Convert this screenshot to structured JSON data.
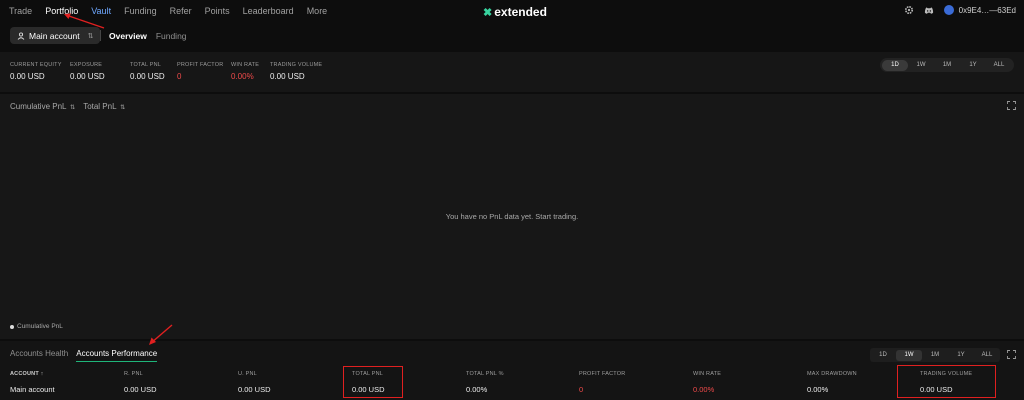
{
  "nav": {
    "links": [
      "Trade",
      "Portfolio",
      "Vault",
      "Funding",
      "Refer",
      "Points",
      "Leaderboard",
      "More"
    ],
    "logo_text": "extended",
    "wallet": "0x9E4…—63Ed"
  },
  "subheader": {
    "account_select": "Main account",
    "tabs": [
      "Overview",
      "Funding"
    ]
  },
  "stats": {
    "items": [
      {
        "label": "CURRENT EQUITY",
        "value": "0.00 USD"
      },
      {
        "label": "EXPOSURE",
        "value": "0.00 USD"
      },
      {
        "label": "TOTAL PNL",
        "value": "0.00 USD"
      },
      {
        "label": "PROFIT FACTOR",
        "value": "0"
      },
      {
        "label": "WIN RATE",
        "value": "0.00%"
      },
      {
        "label": "TRADING VOLUME",
        "value": "0.00 USD"
      }
    ],
    "ranges": [
      "1D",
      "1W",
      "1M",
      "1Y",
      "ALL"
    ],
    "active_range": "1D"
  },
  "chart": {
    "selectors": [
      "Cumulative PnL",
      "Total PnL"
    ],
    "empty_message": "You have no PnL data yet. Start trading.",
    "legend": "Cumulative PnL"
  },
  "accounts": {
    "tabs": [
      "Accounts Health",
      "Accounts Performance"
    ],
    "ranges": [
      "1D",
      "1W",
      "1M",
      "1Y",
      "ALL"
    ],
    "active_range": "1W",
    "columns": [
      "ACCOUNT ↑",
      "R. PNL",
      "U. PNL",
      "TOTAL PNL",
      "TOTAL PNL %",
      "PROFIT FACTOR",
      "WIN RATE",
      "MAX DRAWDOWN",
      "TRADING VOLUME"
    ],
    "rows": [
      [
        "Main account",
        "0.00 USD",
        "0.00 USD",
        "0.00 USD",
        "0.00%",
        "0",
        "0.00%",
        "0.00%",
        "0.00 USD"
      ]
    ]
  },
  "colors": {
    "accent_green": "#1fb57a",
    "negative_red": "#ef4a4a",
    "link_blue": "#6fa8ff",
    "annotation_red": "#e02020"
  }
}
